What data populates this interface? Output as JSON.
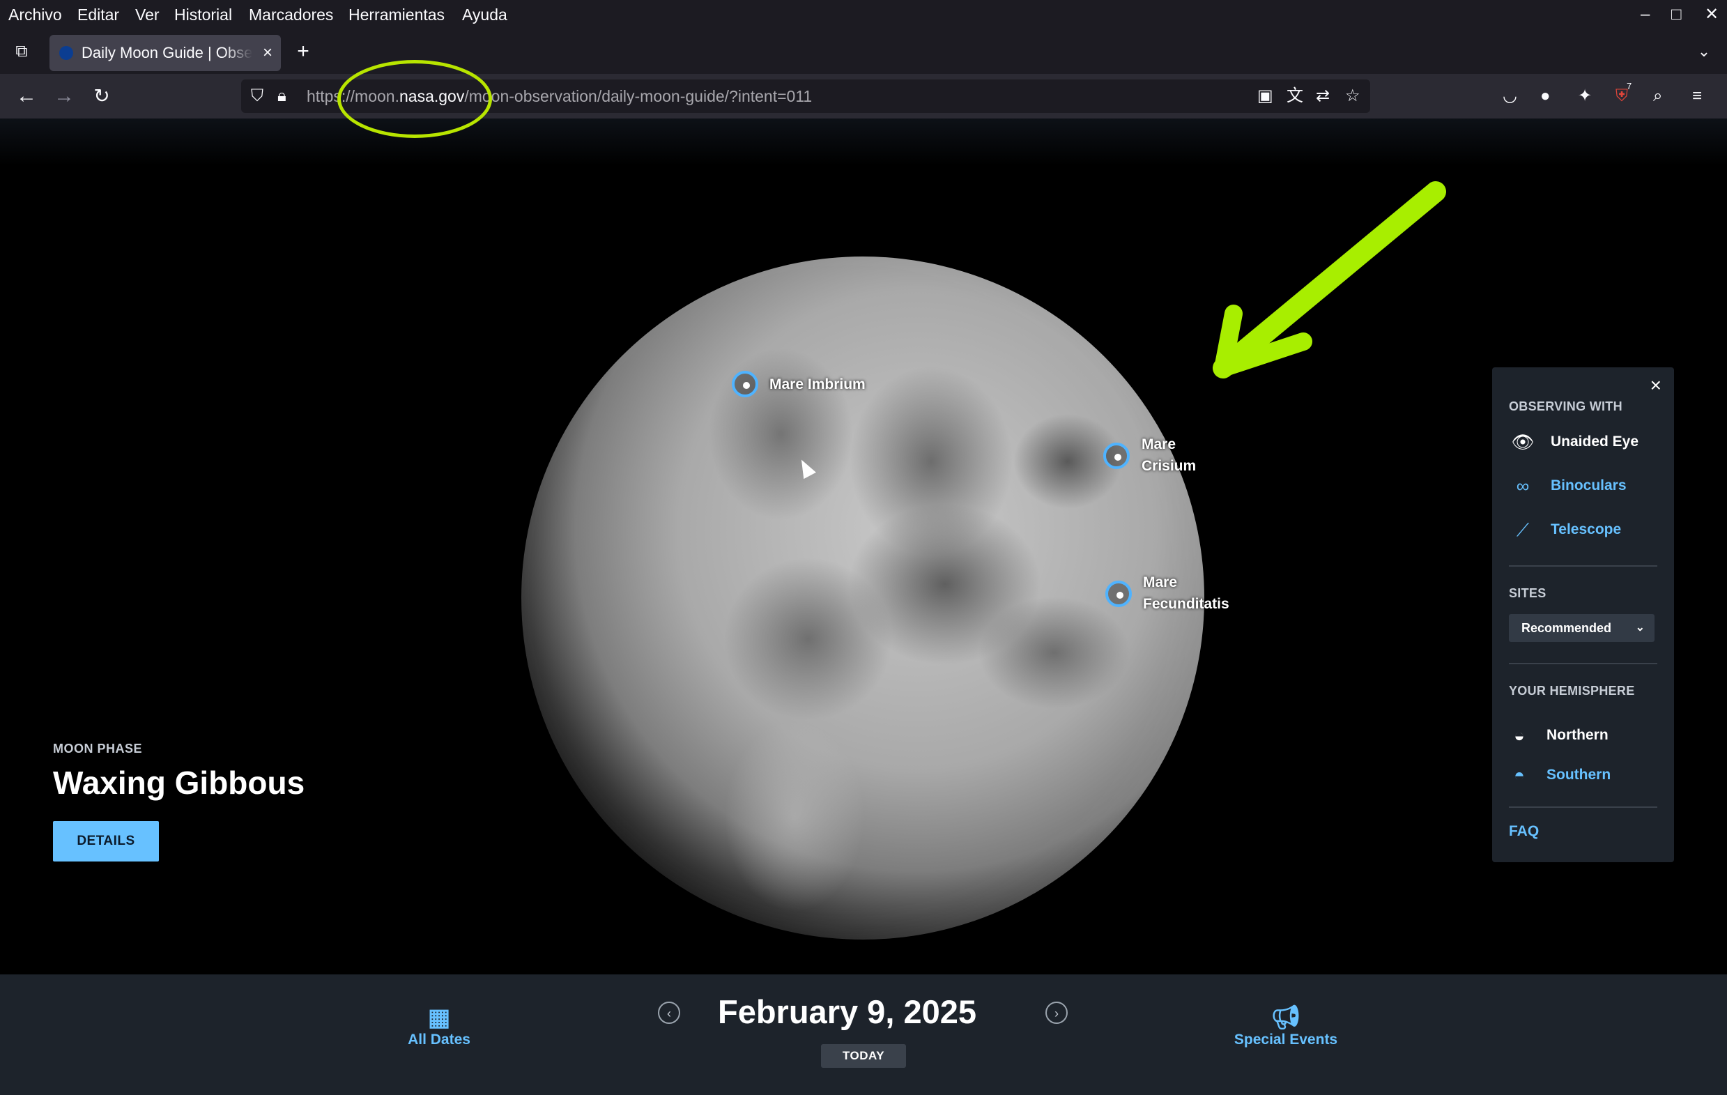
{
  "menubar": {
    "items": [
      "Archivo",
      "Editar",
      "Ver",
      "Historial",
      "Marcadores",
      "Herramientas",
      "Ayuda"
    ]
  },
  "window_controls": {
    "minimize": "–",
    "maximize": "□",
    "close": "✕"
  },
  "tab": {
    "title": "Daily Moon Guide | Observe the Moon",
    "close": "×"
  },
  "new_tab": "+",
  "address": {
    "scheme": "https://",
    "sub": "moon.",
    "domain": "nasa.gov",
    "path": "/moon-observation/daily-moon-guide/?intent=011"
  },
  "extension_badge": "7",
  "moon": {
    "markers": [
      {
        "name": "Mare Imbrium"
      },
      {
        "name": "Mare Crisium"
      },
      {
        "name": "Mare Fecunditatis"
      }
    ]
  },
  "phase": {
    "label": "MOON PHASE",
    "name": "Waxing Gibbous",
    "details_button": "DETAILS"
  },
  "panel": {
    "close": "×",
    "observing_header": "OBSERVING WITH",
    "observing_options": [
      "Unaided Eye",
      "Binoculars",
      "Telescope"
    ],
    "sites_header": "SITES",
    "sites_selected": "Recommended",
    "hemisphere_header": "YOUR HEMISPHERE",
    "hemispheres": [
      "Northern",
      "Southern"
    ],
    "faq": "FAQ"
  },
  "footer": {
    "all_dates": "All Dates",
    "date": "February 9, 2025",
    "today": "TODAY",
    "special_events": "Special Events"
  },
  "colors": {
    "accent": "#67c1ff",
    "marker": "#4fb3ff",
    "annotation": "#b8e500"
  }
}
